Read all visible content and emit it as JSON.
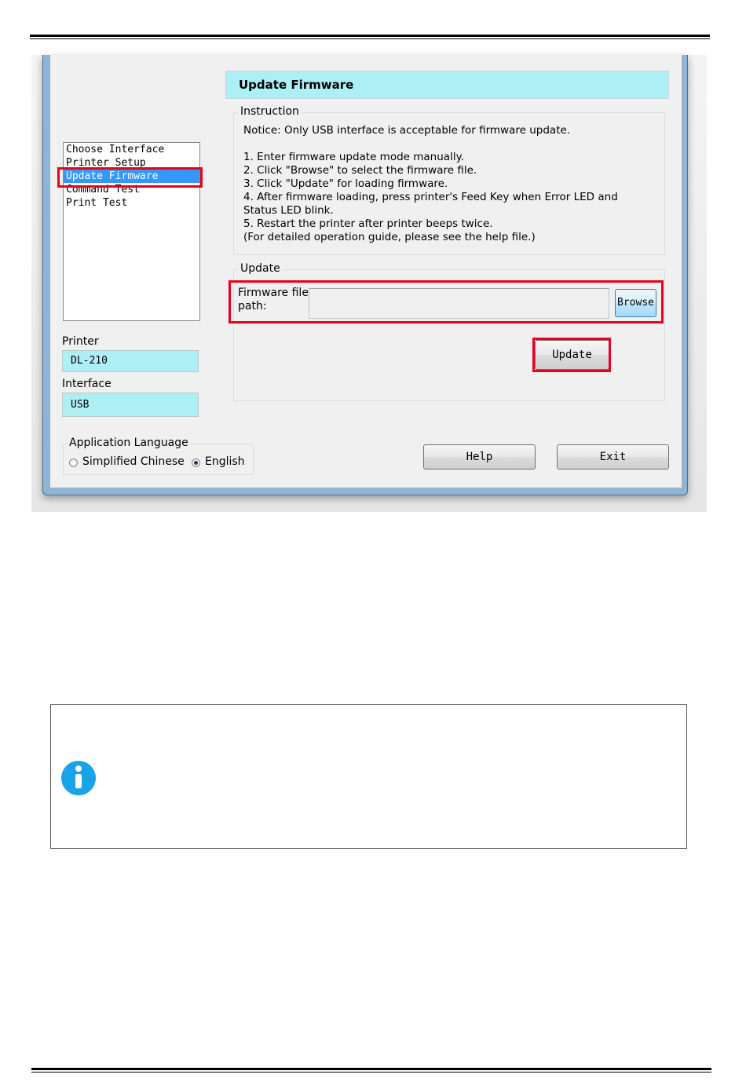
{
  "window": {
    "header_title": "Update Firmware",
    "nav_items": [
      "Choose Interface",
      "Printer Setup",
      "Update Firmware",
      "Command Test",
      "Print Test"
    ],
    "selected_nav_index": 2,
    "printer_label": "Printer",
    "printer_value": "DL-210",
    "interface_label": "Interface",
    "interface_value": "USB",
    "instruction": {
      "title": "Instruction",
      "notice": "Notice: Only USB interface is acceptable for firmware update.",
      "steps": [
        "1. Enter firmware update mode manually.",
        "2. Click \"Browse\" to select the firmware file.",
        "3. Click  \"Update\" for loading firmware.",
        "4. After firmware loading, press printer's Feed Key when Error LED and",
        "Status LED blink.",
        "5. Restart the printer after printer beeps twice.",
        "(For detailed operation guide, please see the help file.)"
      ]
    },
    "update": {
      "title": "Update",
      "file_label_line1": "Firmware file",
      "file_label_line2": "path:",
      "file_path_value": "",
      "browse_label": "Browse",
      "update_label": "Update"
    },
    "language": {
      "title": "Application Language",
      "options": [
        "Simplified Chinese",
        "English"
      ],
      "selected": "English"
    },
    "help_label": "Help",
    "exit_label": "Exit"
  },
  "colors": {
    "highlight_red": "#e8001c",
    "header_cyan": "#aeeef5",
    "selection_blue": "#3399ff",
    "info_icon_blue": "#1aa3e8"
  },
  "icons": {
    "note_icon": "info-icon"
  }
}
